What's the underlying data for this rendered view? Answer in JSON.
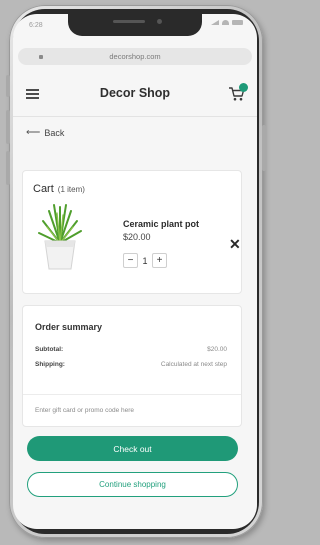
{
  "status": {
    "time": "6:28"
  },
  "browser": {
    "url": "decorshop.com"
  },
  "header": {
    "brand": "Decor Shop",
    "cart_badge_color": "#1e9a78"
  },
  "nav": {
    "back_label": "Back"
  },
  "cart": {
    "title": "Cart",
    "count_label": "(1 item)",
    "item": {
      "name": "Ceramic plant pot",
      "price": "$20.00",
      "quantity": "1",
      "decrement_label": "−",
      "increment_label": "+",
      "remove_label": "✕"
    }
  },
  "summary": {
    "title": "Order summary",
    "rows": [
      {
        "label": "Subtotal:",
        "value": "$20.00"
      },
      {
        "label": "Shipping:",
        "value": "Calculated at next step"
      }
    ],
    "promo_placeholder": "Enter gift card or promo code here"
  },
  "actions": {
    "checkout_label": "Check out",
    "continue_label": "Continue shopping",
    "accent_color": "#1f9977"
  }
}
